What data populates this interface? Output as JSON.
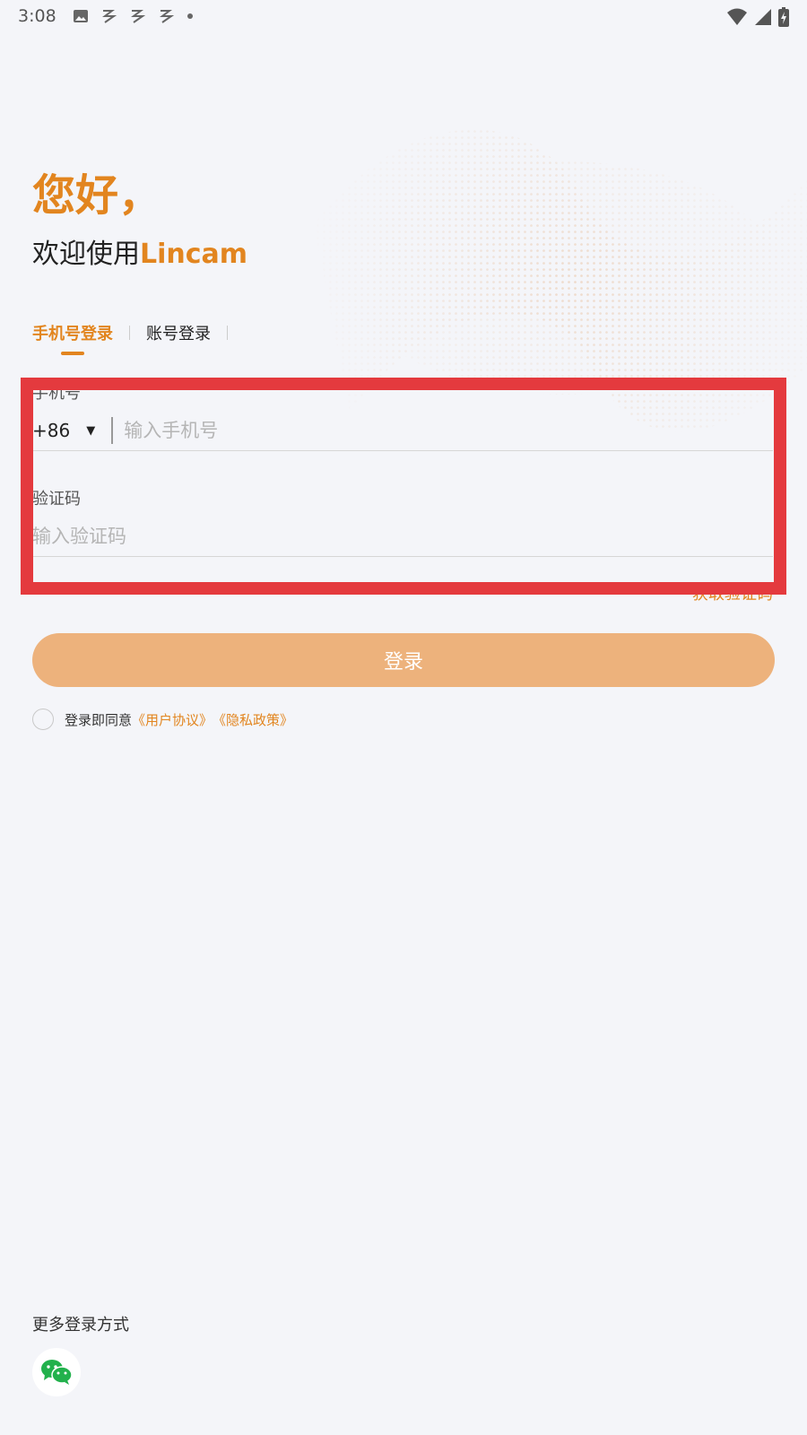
{
  "status_bar": {
    "time": "3:08",
    "icons": [
      "image-icon",
      "app-notify-icon",
      "app-notify-icon",
      "app-notify-icon",
      "dot-icon"
    ],
    "right_icons": [
      "wifi-icon",
      "signal-icon",
      "battery-charging-icon"
    ]
  },
  "header": {
    "greeting": "您好，",
    "welcome_prefix": "欢迎使用",
    "brand": "Lincam"
  },
  "tabs": [
    {
      "label": "手机号登录",
      "active": true
    },
    {
      "label": "账号登录",
      "active": false
    }
  ],
  "form": {
    "phone_label": "手机号",
    "country_code": "+86",
    "phone_placeholder": "输入手机号",
    "code_label": "验证码",
    "code_placeholder": "输入验证码",
    "get_code": "获取验证码",
    "login_button": "登录"
  },
  "agreement": {
    "prefix": "登录即同意",
    "user_agreement": "《用户协议》",
    "privacy_policy": "《隐私政策》",
    "checked": false
  },
  "more_login": {
    "label": "更多登录方式",
    "methods": [
      "wechat-icon"
    ]
  },
  "colors": {
    "accent": "#e2851f",
    "button": "#edb27c",
    "highlight": "#e43a3e",
    "wechat": "#22b14c"
  }
}
